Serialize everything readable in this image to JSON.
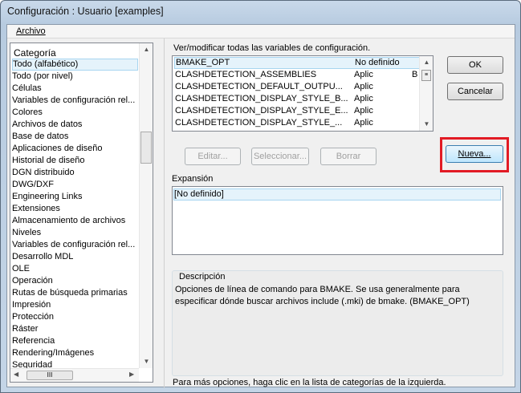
{
  "window": {
    "title": "Configuración : Usuario [examples]"
  },
  "menu": {
    "file": "Archivo"
  },
  "categories": {
    "header": "Categoría",
    "items": [
      "Todo (alfabético)",
      "Todo (por nivel)",
      "Células",
      "Variables de configuración rel...",
      "Colores",
      "Archivos de datos",
      "Base de datos",
      "Aplicaciones de diseño",
      "Historial de diseño",
      "DGN distribuido",
      "DWG/DXF",
      "Engineering Links",
      "Extensiones",
      "Almacenamiento de archivos",
      "Niveles",
      "Variables de configuración rel...",
      "Desarrollo MDL",
      "OLE",
      "Operación",
      "Rutas de búsqueda primarias",
      "Impresión",
      "Protección",
      "Ráster",
      "Referencia",
      "Rendering/Imágenes",
      "Seguridad"
    ],
    "selected": 0
  },
  "variables": {
    "label": "Ver/modificar todas las variables de configuración.",
    "rows": [
      {
        "name": "BMAKE_OPT",
        "level": "No definido",
        "flag": ""
      },
      {
        "name": "CLASHDETECTION_ASSEMBLIES",
        "level": "Aplic",
        "flag": "B"
      },
      {
        "name": "CLASHDETECTION_DEFAULT_OUTPU...",
        "level": "Aplic",
        "flag": ""
      },
      {
        "name": "CLASHDETECTION_DISPLAY_STYLE_B...",
        "level": "Aplic",
        "flag": ""
      },
      {
        "name": "CLASHDETECTION_DISPLAY_STYLE_E...",
        "level": "Aplic",
        "flag": ""
      },
      {
        "name": "CLASHDETECTION_DISPLAY_STYLE_...",
        "level": "Aplic",
        "flag": ""
      }
    ]
  },
  "buttons": {
    "ok": "OK",
    "cancel": "Cancelar",
    "edit": "Editar...",
    "select": "Seleccionar...",
    "delete": "Borrar",
    "new": "Nueva..."
  },
  "expansion": {
    "label": "Expansión",
    "value": "[No definido]"
  },
  "description": {
    "label": "Descripción",
    "text": "Opciones de línea de comando para BMAKE.  Se usa generalmente para especificar dónde buscar archivos include (.mki) de bmake.  (BMAKE_OPT)"
  },
  "footer": "Para más opciones, haga clic en la lista de categorías de la izquierda.",
  "colors": {
    "highlight": "#e21b24"
  }
}
